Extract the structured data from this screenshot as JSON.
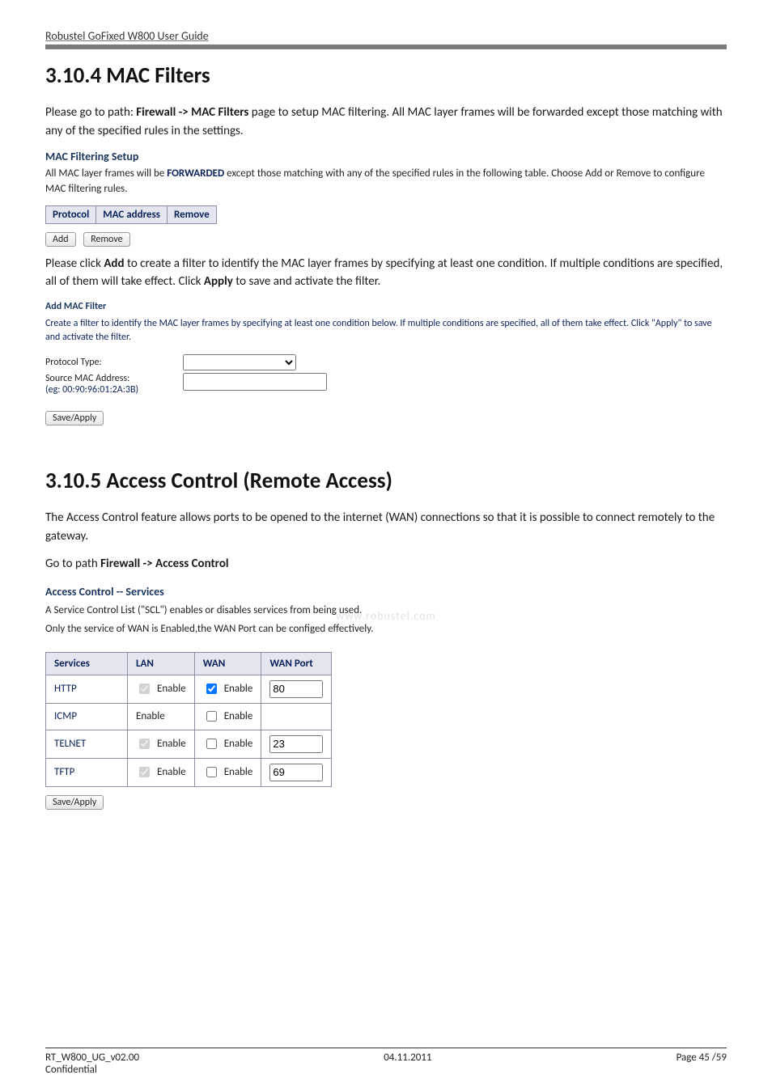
{
  "header": {
    "guide_title": "Robustel GoFixed W800 User Guide"
  },
  "section_mac": {
    "heading": "3.10.4 MAC Filters",
    "intro_pre": "Please go to path: ",
    "intro_path": "Firewall -> MAC Filters",
    "intro_post": " page to setup MAC filtering. All MAC layer frames will be forwarded except those matching with any of the specified rules in the settings.",
    "setup_title": "MAC Filtering Setup",
    "forwarded_pre": "All MAC layer frames will be ",
    "forwarded_word": "FORWARDED",
    "forwarded_post": " except those matching with any of the specified rules in the following table. Choose Add or Remove to configure MAC filtering rules.",
    "table_headers": [
      "Protocol",
      "MAC address",
      "Remove"
    ],
    "btn_add": "Add",
    "btn_remove": "Remove",
    "click_add_pre": "Please click ",
    "click_add_word": "Add",
    "click_add_mid": " to create a filter to identify the MAC layer frames by specifying at least one condition. If multiple conditions are specified, all of them will take effect. Click ",
    "click_apply_word": "Apply",
    "click_add_post": " to save and activate the filter.",
    "add_filter_title": "Add MAC Filter",
    "add_filter_desc": "Create a filter to identify the MAC layer frames by specifying at least one condition below. If multiple conditions are specified, all of them take effect. Click \"Apply\" to save and activate the filter.",
    "protocol_type_label": "Protocol Type:",
    "source_mac_label": "Source MAC Address:",
    "source_mac_eg": "(eg: 00:90:96:01:2A:3B)",
    "btn_save_apply": "Save/Apply"
  },
  "section_ac": {
    "heading": "3.10.5 Access Control (Remote Access)",
    "intro": "The Access Control feature allows ports to be opened to the internet (WAN) connections so that it is possible to connect remotely to the gateway.",
    "goto_pre": "Go to path ",
    "goto_path": "Firewall -> Access Control",
    "scl_title": "Access Control -- Services",
    "scl_line1": "A Service Control List (\"SCL\") enables or disables services from being used.",
    "scl_line2": "Only the service of WAN is Enabled,the WAN Port can be configed effectively.",
    "table": {
      "headers": [
        "Services",
        "LAN",
        "WAN",
        "WAN Port"
      ],
      "enable_label": "Enable",
      "rows": [
        {
          "service": "HTTP",
          "lan_checked": true,
          "lan_disabled": true,
          "wan_checked": true,
          "wan_disabled": false,
          "port": "80"
        },
        {
          "service": "ICMP",
          "lan_checked": null,
          "lan_disabled": false,
          "wan_checked": false,
          "wan_disabled": false,
          "port": null
        },
        {
          "service": "TELNET",
          "lan_checked": true,
          "lan_disabled": true,
          "wan_checked": false,
          "wan_disabled": false,
          "port": "23"
        },
        {
          "service": "TFTP",
          "lan_checked": true,
          "lan_disabled": true,
          "wan_checked": false,
          "wan_disabled": false,
          "port": "69"
        }
      ]
    },
    "btn_save_apply": "Save/Apply"
  },
  "watermark": "www.robustel.com",
  "footer": {
    "left": "RT_W800_UG_v02.00",
    "center": "04.11.2011",
    "right": "Page 45 /59",
    "conf": "Confidential"
  }
}
